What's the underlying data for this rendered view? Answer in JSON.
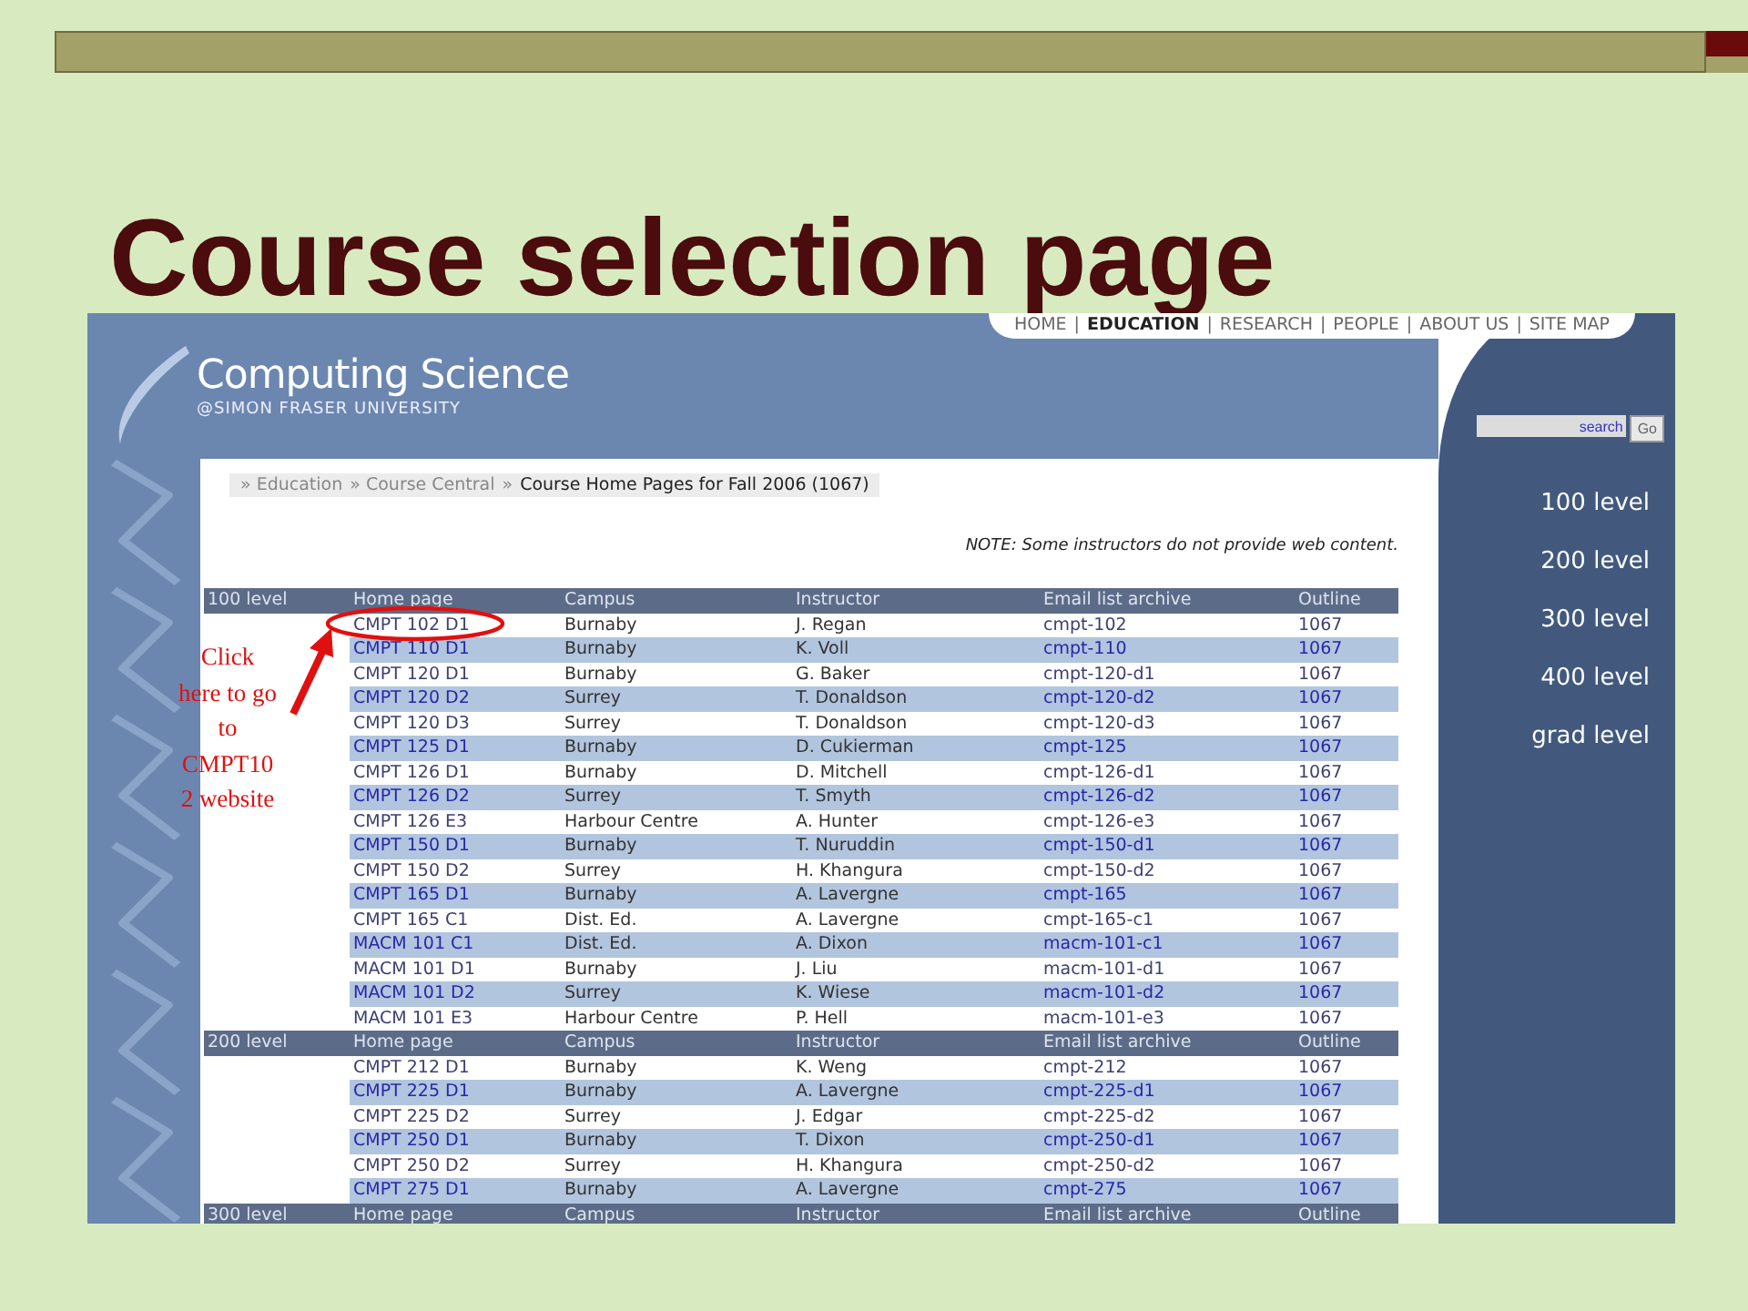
{
  "slide": {
    "title": "Course selection page"
  },
  "site": {
    "logo_title": "Computing Science",
    "logo_subtitle": "@SIMON FRASER UNIVERSITY",
    "nav": [
      {
        "label": "HOME",
        "selected": false
      },
      {
        "label": "EDUCATION",
        "selected": true
      },
      {
        "label": "RESEARCH",
        "selected": false
      },
      {
        "label": "PEOPLE",
        "selected": false
      },
      {
        "label": "ABOUT US",
        "selected": false
      },
      {
        "label": "SITE MAP",
        "selected": false
      }
    ],
    "search": {
      "placeholder": "search",
      "button": "Go"
    },
    "sidebar": [
      "100 level",
      "200 level",
      "300 level",
      "400 level",
      "grad level"
    ],
    "breadcrumb": [
      {
        "label": "» Education",
        "current": false
      },
      {
        "label": "» Course Central",
        "current": false
      },
      {
        "label": "» ",
        "current": false
      },
      {
        "label": "Course Home Pages for Fall 2006 (1067)",
        "current": true
      }
    ],
    "note": "NOTE: Some instructors do not provide web content.",
    "sections": [
      {
        "level": "100 level",
        "columns": [
          "Home page",
          "Campus",
          "Instructor",
          "Email list archive",
          "Outline"
        ],
        "rows": [
          [
            "CMPT 102 D1",
            "Burnaby",
            "J. Regan",
            "cmpt-102",
            "1067"
          ],
          [
            "CMPT 110 D1",
            "Burnaby",
            "K. Voll",
            "cmpt-110",
            "1067"
          ],
          [
            "CMPT 120 D1",
            "Burnaby",
            "G. Baker",
            "cmpt-120-d1",
            "1067"
          ],
          [
            "CMPT 120 D2",
            "Surrey",
            "T. Donaldson",
            "cmpt-120-d2",
            "1067"
          ],
          [
            "CMPT 120 D3",
            "Surrey",
            "T. Donaldson",
            "cmpt-120-d3",
            "1067"
          ],
          [
            "CMPT 125 D1",
            "Burnaby",
            "D. Cukierman",
            "cmpt-125",
            "1067"
          ],
          [
            "CMPT 126 D1",
            "Burnaby",
            "D. Mitchell",
            "cmpt-126-d1",
            "1067"
          ],
          [
            "CMPT 126 D2",
            "Surrey",
            "T. Smyth",
            "cmpt-126-d2",
            "1067"
          ],
          [
            "CMPT 126 E3",
            "Harbour Centre",
            "A. Hunter",
            "cmpt-126-e3",
            "1067"
          ],
          [
            "CMPT 150 D1",
            "Burnaby",
            "T. Nuruddin",
            "cmpt-150-d1",
            "1067"
          ],
          [
            "CMPT 150 D2",
            "Surrey",
            "H. Khangura",
            "cmpt-150-d2",
            "1067"
          ],
          [
            "CMPT 165 D1",
            "Burnaby",
            "A. Lavergne",
            "cmpt-165",
            "1067"
          ],
          [
            "CMPT 165 C1",
            "Dist. Ed.",
            "A. Lavergne",
            "cmpt-165-c1",
            "1067"
          ],
          [
            "MACM 101 C1",
            "Dist. Ed.",
            "A. Dixon",
            "macm-101-c1",
            "1067"
          ],
          [
            "MACM 101 D1",
            "Burnaby",
            "J. Liu",
            "macm-101-d1",
            "1067"
          ],
          [
            "MACM 101 D2",
            "Surrey",
            "K. Wiese",
            "macm-101-d2",
            "1067"
          ],
          [
            "MACM 101 E3",
            "Harbour Centre",
            "P. Hell",
            "macm-101-e3",
            "1067"
          ]
        ]
      },
      {
        "level": "200 level",
        "columns": [
          "Home page",
          "Campus",
          "Instructor",
          "Email list archive",
          "Outline"
        ],
        "rows": [
          [
            "CMPT 212 D1",
            "Burnaby",
            "K. Weng",
            "cmpt-212",
            "1067"
          ],
          [
            "CMPT 225 D1",
            "Burnaby",
            "A. Lavergne",
            "cmpt-225-d1",
            "1067"
          ],
          [
            "CMPT 225 D2",
            "Surrey",
            "J. Edgar",
            "cmpt-225-d2",
            "1067"
          ],
          [
            "CMPT 250 D1",
            "Burnaby",
            "T. Dixon",
            "cmpt-250-d1",
            "1067"
          ],
          [
            "CMPT 250 D2",
            "Surrey",
            "H. Khangura",
            "cmpt-250-d2",
            "1067"
          ],
          [
            "CMPT 275 D1",
            "Burnaby",
            "A. Lavergne",
            "cmpt-275",
            "1067"
          ]
        ]
      },
      {
        "level": "300 level",
        "columns": [
          "Home page",
          "Campus",
          "Instructor",
          "Email list archive",
          "Outline"
        ]
      }
    ]
  },
  "nav_separator": "|",
  "annotation": {
    "lines": [
      "Click",
      "here to go",
      "to",
      "CMPT10",
      "2 website"
    ]
  }
}
